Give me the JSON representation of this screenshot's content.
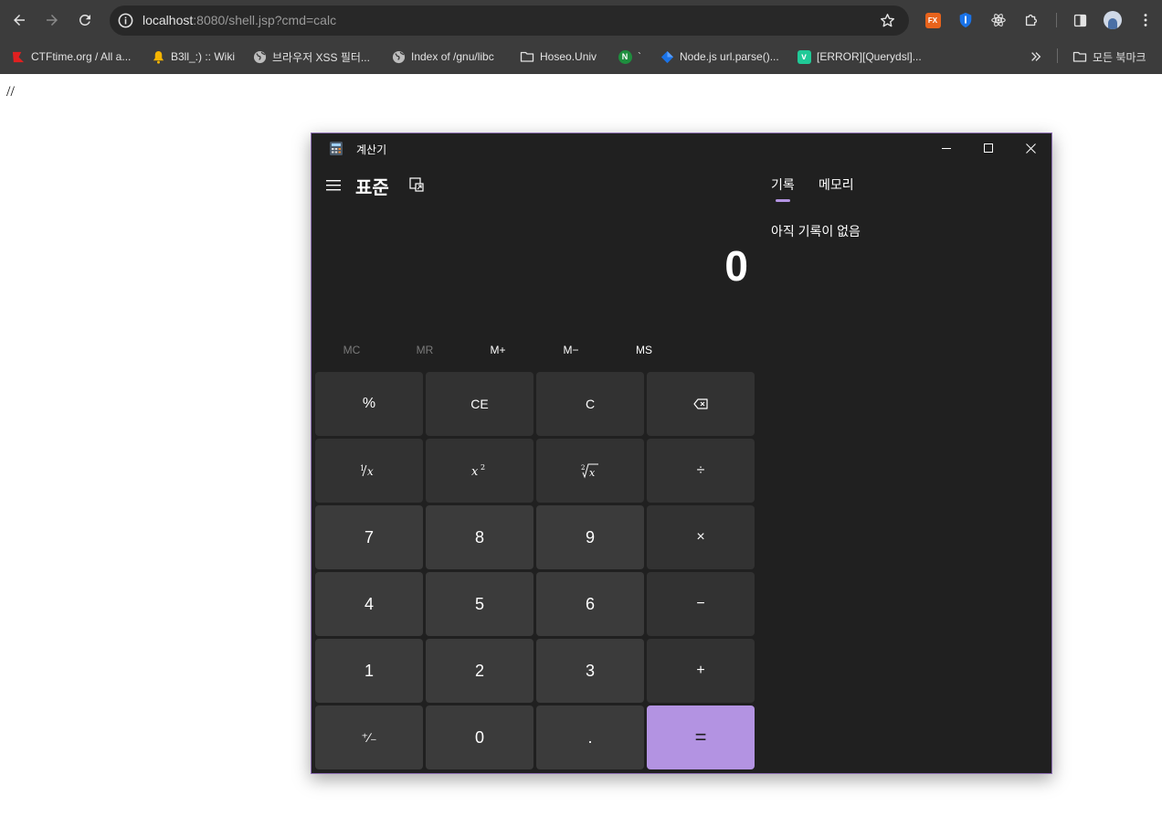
{
  "browser": {
    "url_host": "localhost",
    "url_rest": ":8080/shell.jsp?cmd=calc",
    "bookmarks": [
      {
        "label": "CTFtime.org / All a...",
        "icon": "ctftime-icon"
      },
      {
        "label": "B3ll_:) :: Wiki",
        "icon": "bell-icon"
      },
      {
        "label": "브라우저 XSS 필터...",
        "icon": "globe-icon"
      },
      {
        "label": "Index of /gnu/libc",
        "icon": "globe-icon"
      },
      {
        "label": "Hoseo.Univ",
        "icon": "folder-icon"
      },
      {
        "label": "`",
        "icon": "n-badge-icon"
      },
      {
        "label": "Node.js url.parse()...",
        "icon": "diamond-icon"
      },
      {
        "label": "[ERROR][Querydsl]...",
        "icon": "v-badge-icon"
      }
    ],
    "all_bookmarks_label": "모든 북마크"
  },
  "page": {
    "text": "//"
  },
  "calculator": {
    "window_title": "계산기",
    "mode_title": "표준",
    "display_value": "0",
    "memory_buttons": [
      {
        "label": "MC",
        "enabled": false
      },
      {
        "label": "MR",
        "enabled": false
      },
      {
        "label": "M+",
        "enabled": true
      },
      {
        "label": "M−",
        "enabled": true
      },
      {
        "label": "MS",
        "enabled": true
      }
    ],
    "keys": {
      "percent": "%",
      "ce": "CE",
      "c": "C",
      "seven": "7",
      "eight": "8",
      "nine": "9",
      "four": "4",
      "five": "5",
      "six": "6",
      "one": "1",
      "two": "2",
      "three": "3",
      "zero": "0",
      "decimal": ".",
      "negate": "⁺∕₋",
      "divide": "÷",
      "multiply": "×",
      "subtract": "−",
      "add": "+",
      "equals": "="
    },
    "tabs": {
      "history": "기록",
      "memory": "메모리"
    },
    "history_empty": "아직 기록이 없음",
    "accent_color": "#b393e2"
  }
}
